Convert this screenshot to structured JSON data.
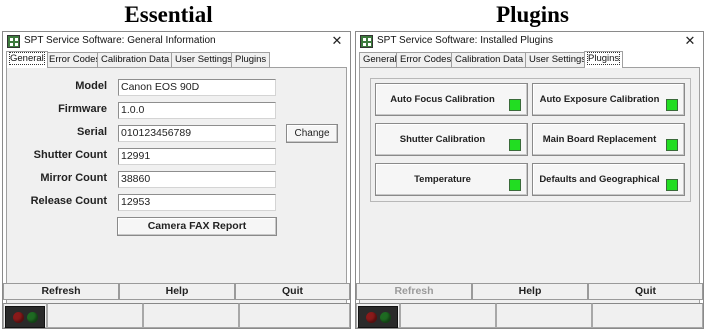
{
  "captions": {
    "left": "Essential",
    "right": "Plugins"
  },
  "windows": {
    "general": {
      "title": "SPT Service Software: General Information",
      "close_glyph": "✕",
      "tabs": [
        "General",
        "Error Codes",
        "Calibration Data",
        "User Settings",
        "Plugins"
      ],
      "active_tab": "General",
      "fields": [
        {
          "label": "Model",
          "value": "Canon EOS 90D"
        },
        {
          "label": "Firmware",
          "value": "1.0.0"
        },
        {
          "label": "Serial",
          "value": "010123456789"
        },
        {
          "label": "Shutter Count",
          "value": "12991"
        },
        {
          "label": "Mirror Count",
          "value": "38860"
        },
        {
          "label": "Release Count",
          "value": "12953"
        }
      ],
      "change_button": "Change",
      "fax_button": "Camera FAX Report",
      "bottom_buttons": [
        "Refresh",
        "Help",
        "Quit"
      ],
      "refresh_enabled": true
    },
    "plugins": {
      "title": "SPT Service Software: Installed Plugins",
      "close_glyph": "✕",
      "tabs": [
        "General",
        "Error Codes",
        "Calibration Data",
        "User Settings",
        "Plugins"
      ],
      "active_tab": "Plugins",
      "plugins": [
        {
          "label": "Auto Focus Calibration",
          "status_color": "#22dd22"
        },
        {
          "label": "Auto Exposure Calibration",
          "status_color": "#22dd22"
        },
        {
          "label": "Shutter Calibration",
          "status_color": "#22dd22"
        },
        {
          "label": "Main Board Replacement",
          "status_color": "#22dd22"
        },
        {
          "label": "Temperature",
          "status_color": "#22dd22"
        },
        {
          "label": "Defaults and Geographical",
          "status_color": "#22dd22"
        }
      ],
      "bottom_buttons": [
        "Refresh",
        "Help",
        "Quit"
      ],
      "refresh_enabled": false
    }
  },
  "icons": {
    "app": "app-grid-icon",
    "close": "close-icon",
    "status": "traffic-light-icon",
    "plugin_status": "status-led-icon"
  }
}
